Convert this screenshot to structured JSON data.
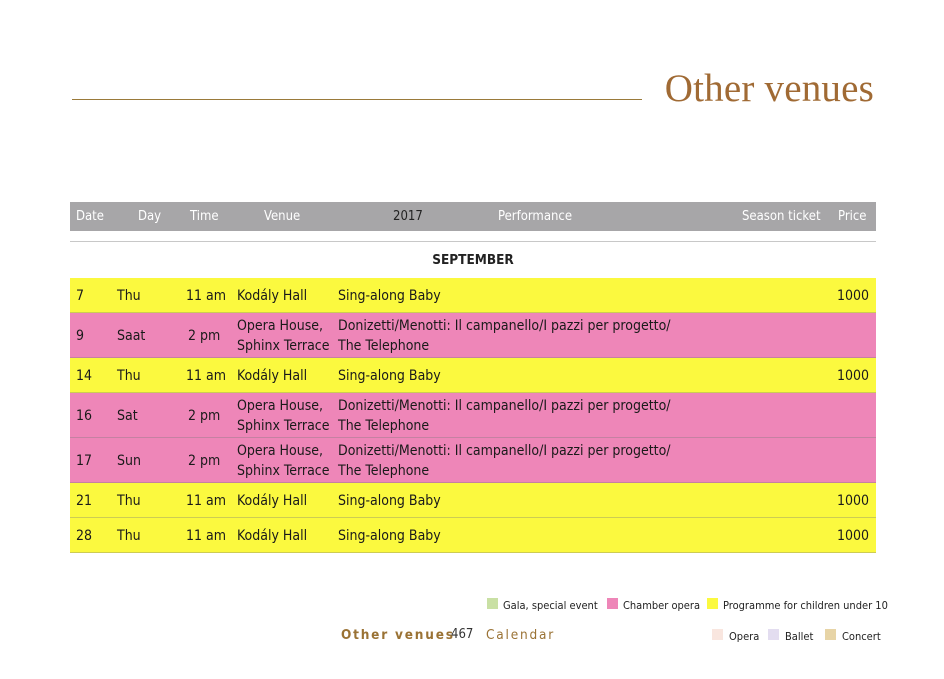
{
  "page": {
    "title": "Other venues"
  },
  "table": {
    "headers": {
      "date": "Date",
      "day": "Day",
      "time": "Time",
      "venue": "Venue",
      "year": "2017",
      "performance": "Performance",
      "season": "Season ticket",
      "price": "Price"
    },
    "month": "SEPTEMBER",
    "rows": [
      {
        "date": "7",
        "day": "Thu",
        "time": "11 am",
        "venue1": "Kodály Hall",
        "venue2": "",
        "perf1": "Sing-along Baby",
        "perf2": "",
        "price": "1000",
        "color": "yellow"
      },
      {
        "date": "9",
        "day": "Saat",
        "time": "2 pm",
        "venue1": "Opera House,",
        "venue2": "Sphinx Terrace",
        "perf1": "Donizetti/Menotti: Il campanello/I pazzi per progetto/",
        "perf2": "The Telephone",
        "price": "",
        "color": "pink"
      },
      {
        "date": "14",
        "day": "Thu",
        "time": "11 am",
        "venue1": "Kodály Hall",
        "venue2": "",
        "perf1": "Sing-along Baby",
        "perf2": "",
        "price": "1000",
        "color": "yellow"
      },
      {
        "date": "16",
        "day": "Sat",
        "time": "2 pm",
        "venue1": "Opera House,",
        "venue2": "Sphinx Terrace",
        "perf1": "Donizetti/Menotti: Il campanello/I pazzi per progetto/",
        "perf2": "The Telephone",
        "price": "",
        "color": "pink"
      },
      {
        "date": "17",
        "day": "Sun",
        "time": "2 pm",
        "venue1": "Opera House,",
        "venue2": "Sphinx Terrace",
        "perf1": "Donizetti/Menotti: Il campanello/I pazzi per progetto/",
        "perf2": "The Telephone",
        "price": "",
        "color": "pink"
      },
      {
        "date": "21",
        "day": "Thu",
        "time": "11 am",
        "venue1": "Kodály Hall",
        "venue2": "",
        "perf1": "Sing-along Baby",
        "perf2": "",
        "price": "1000",
        "color": "yellow"
      },
      {
        "date": "28",
        "day": "Thu",
        "time": "11 am",
        "venue1": "Kodály Hall",
        "venue2": "",
        "perf1": "Sing-along Baby",
        "perf2": "",
        "price": "1000",
        "color": "yellow"
      }
    ]
  },
  "legend": {
    "gala": {
      "label": "Gala, special event",
      "color": "#c9e0a4"
    },
    "chamber": {
      "label": "Chamber opera",
      "color": "#ee86b8"
    },
    "children": {
      "label": "Programme for children under 10",
      "color": "#fbf93f"
    },
    "opera": {
      "label": "Opera",
      "color": "#f9e6df"
    },
    "ballet": {
      "label": "Ballet",
      "color": "#e3ddf0"
    },
    "concert": {
      "label": "Concert",
      "color": "#e7d4a6"
    }
  },
  "footer": {
    "section": "Other venues",
    "page_number": "467",
    "chapter": "Calendar"
  }
}
